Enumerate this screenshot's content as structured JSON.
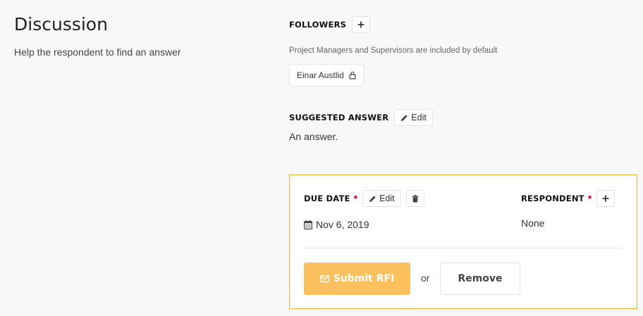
{
  "header": {
    "title": "Discussion",
    "subtitle": "Help the respondent to find an answer"
  },
  "followers": {
    "label": "FOLLOWERS",
    "add_icon": "plus-icon",
    "note": "Project Managers and Supervisors are included by default",
    "chips": [
      {
        "name": "Einar Austlid",
        "icon": "lock-icon"
      }
    ]
  },
  "suggested_answer": {
    "label": "SUGGESTED ANSWER",
    "edit_label": "Edit",
    "edit_icon": "pencil-icon",
    "text": "An answer."
  },
  "due_date": {
    "label": "DUE DATE",
    "required_mark": "*",
    "edit_label": "Edit",
    "edit_icon": "pencil-icon",
    "delete_icon": "trash-icon",
    "calendar_icon": "calendar-icon",
    "value": "Nov 6, 2019"
  },
  "respondent": {
    "label": "RESPONDENT",
    "required_mark": "*",
    "add_icon": "plus-icon",
    "value": "None"
  },
  "actions": {
    "submit_label": "Submit RFI",
    "submit_icon": "envelope-icon",
    "or_text": "or",
    "remove_label": "Remove"
  },
  "colors": {
    "accent": "#fcc15e",
    "card_border": "#f0b040",
    "required": "#d0021b"
  }
}
